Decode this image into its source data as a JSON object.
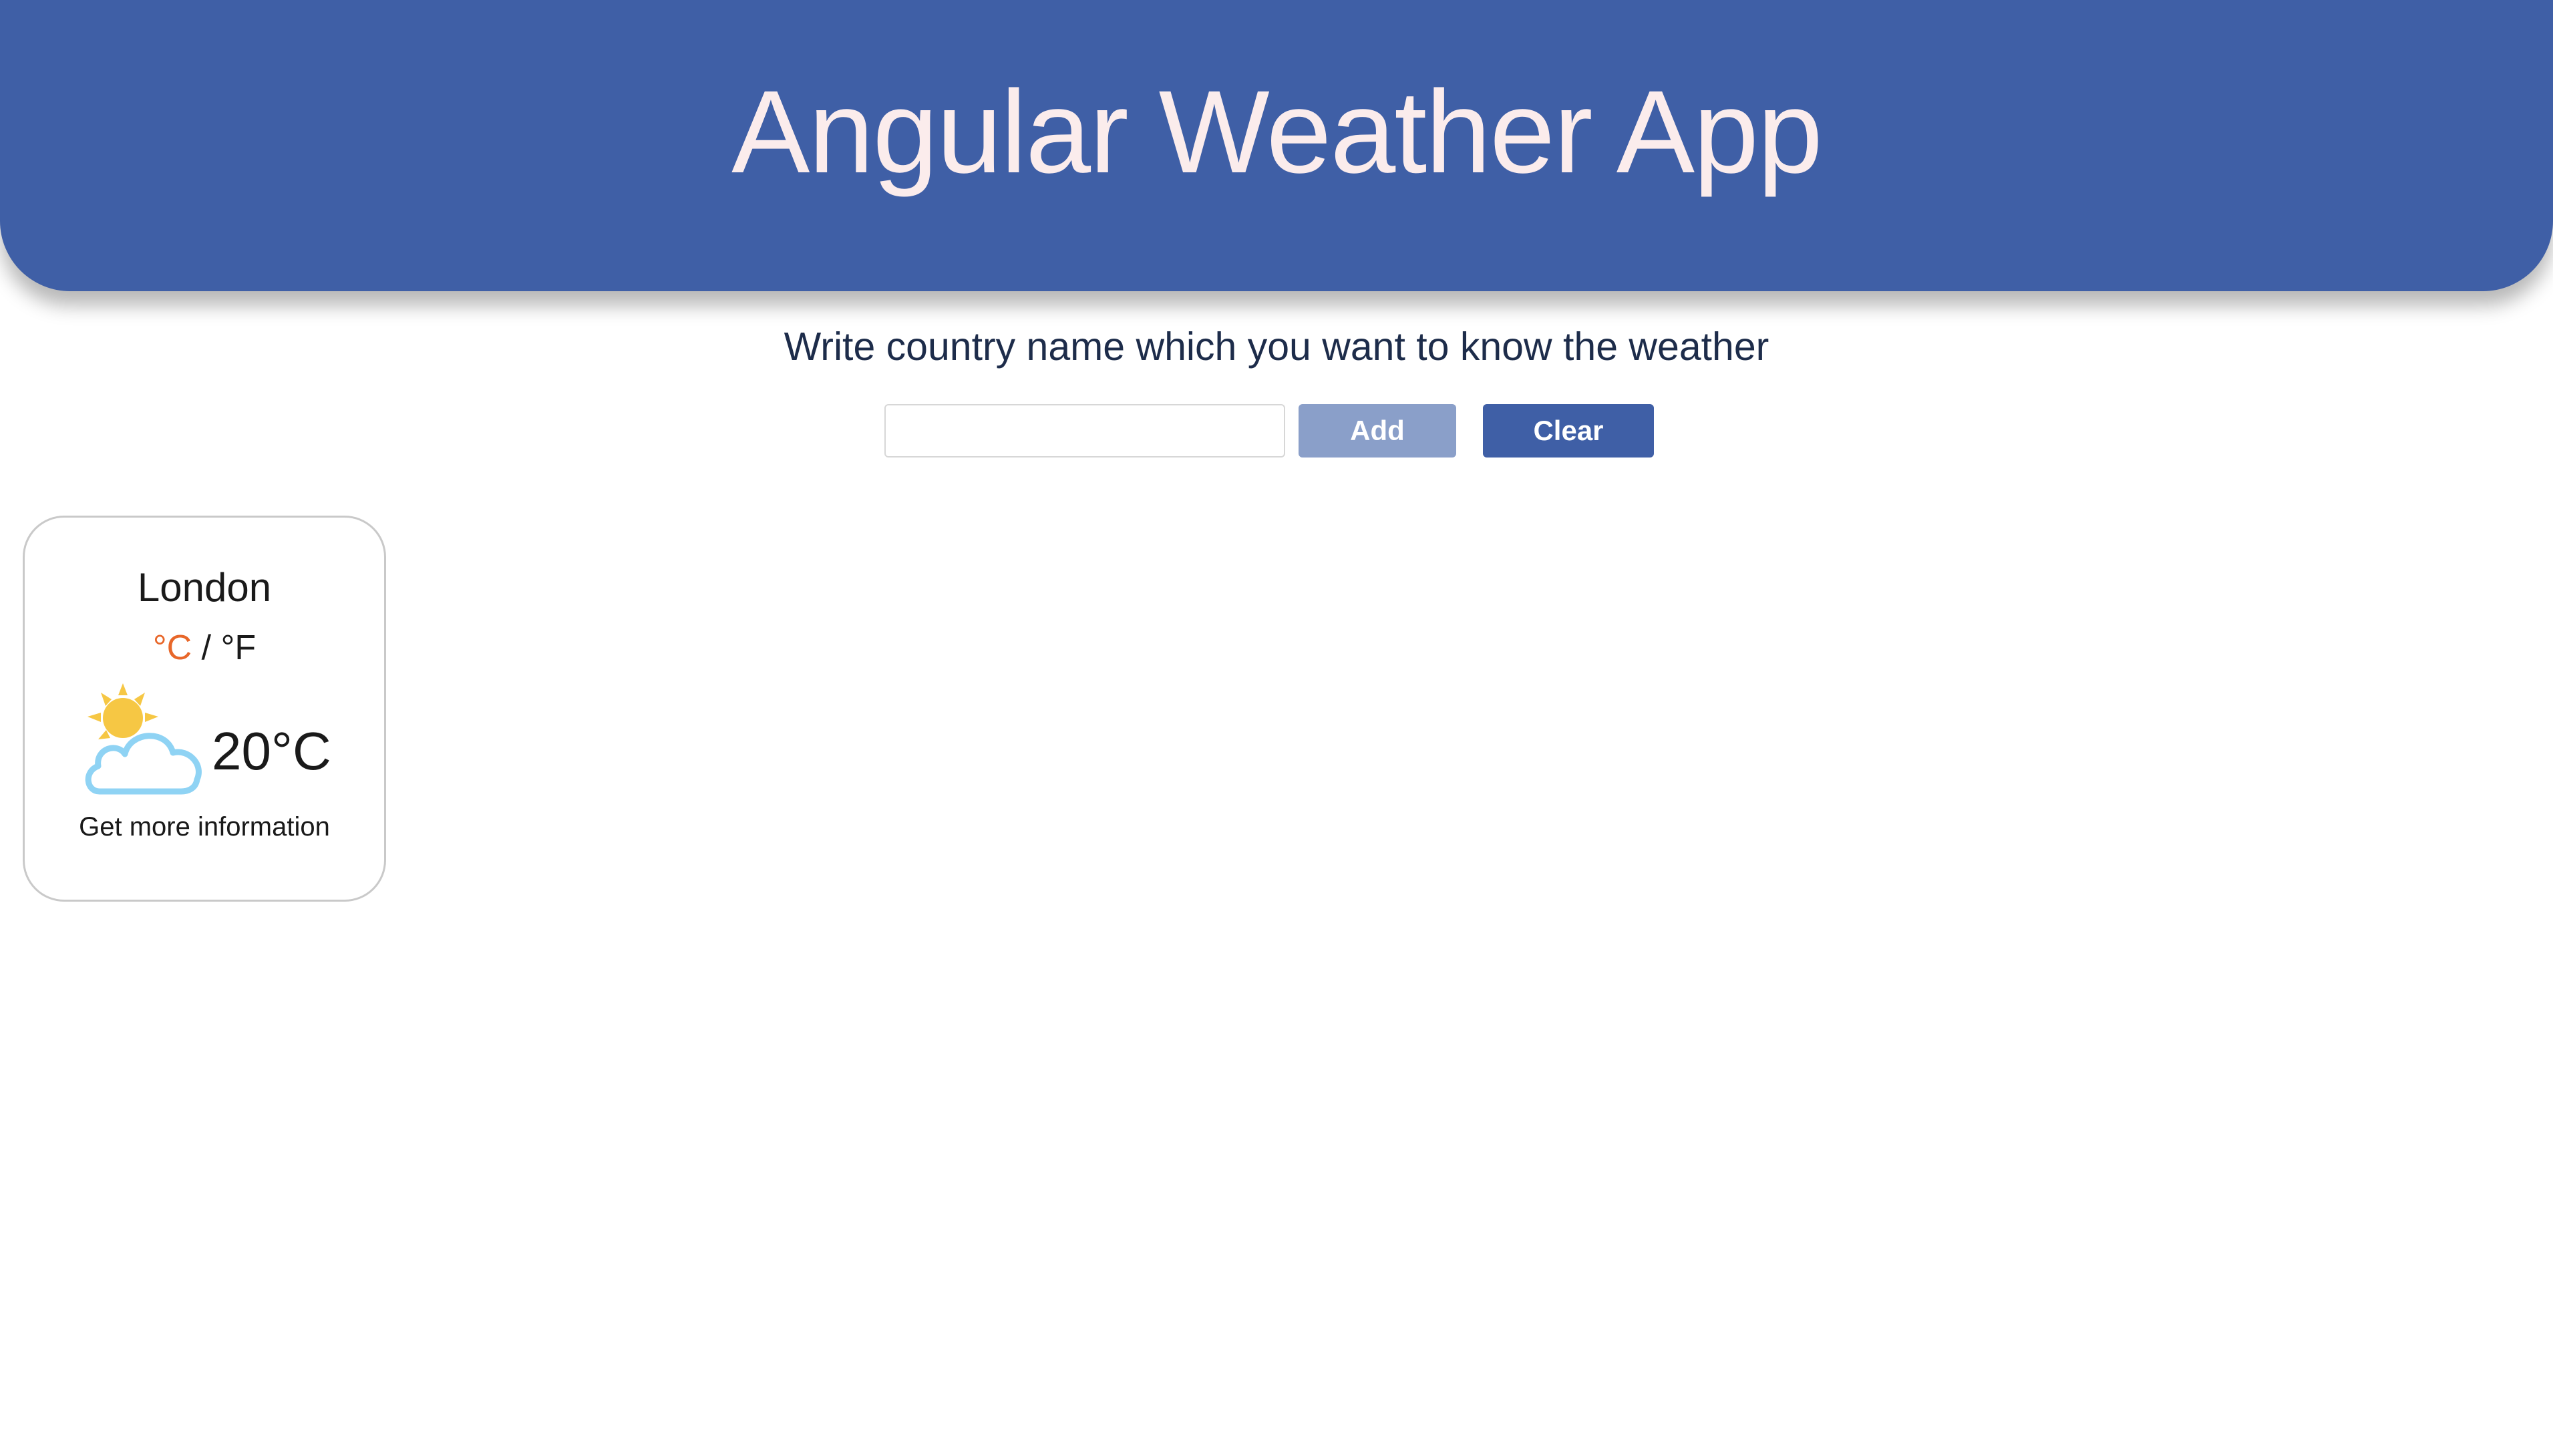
{
  "header": {
    "title": "Angular Weather App"
  },
  "search": {
    "prompt": "Write country name which you want to know the weather",
    "input_value": "",
    "placeholder": "",
    "add_label": "Add",
    "clear_label": "Clear"
  },
  "cards": [
    {
      "city": "London",
      "unit_celsius": "°C",
      "unit_separator": " / ",
      "unit_fahrenheit": "°F",
      "active_unit": "celsius",
      "active_unit_color": "#e8672a",
      "temperature": "20°C",
      "icon": "partly-cloudy-icon",
      "more_label": "Get more information"
    }
  ],
  "colors": {
    "header_bg": "#3f5fa6",
    "header_text": "#fbecec",
    "add_button_bg": "#8a9fc9",
    "clear_button_bg": "#3f5fa6",
    "sun": "#f6c744",
    "cloud_stroke": "#8fd3f4"
  }
}
